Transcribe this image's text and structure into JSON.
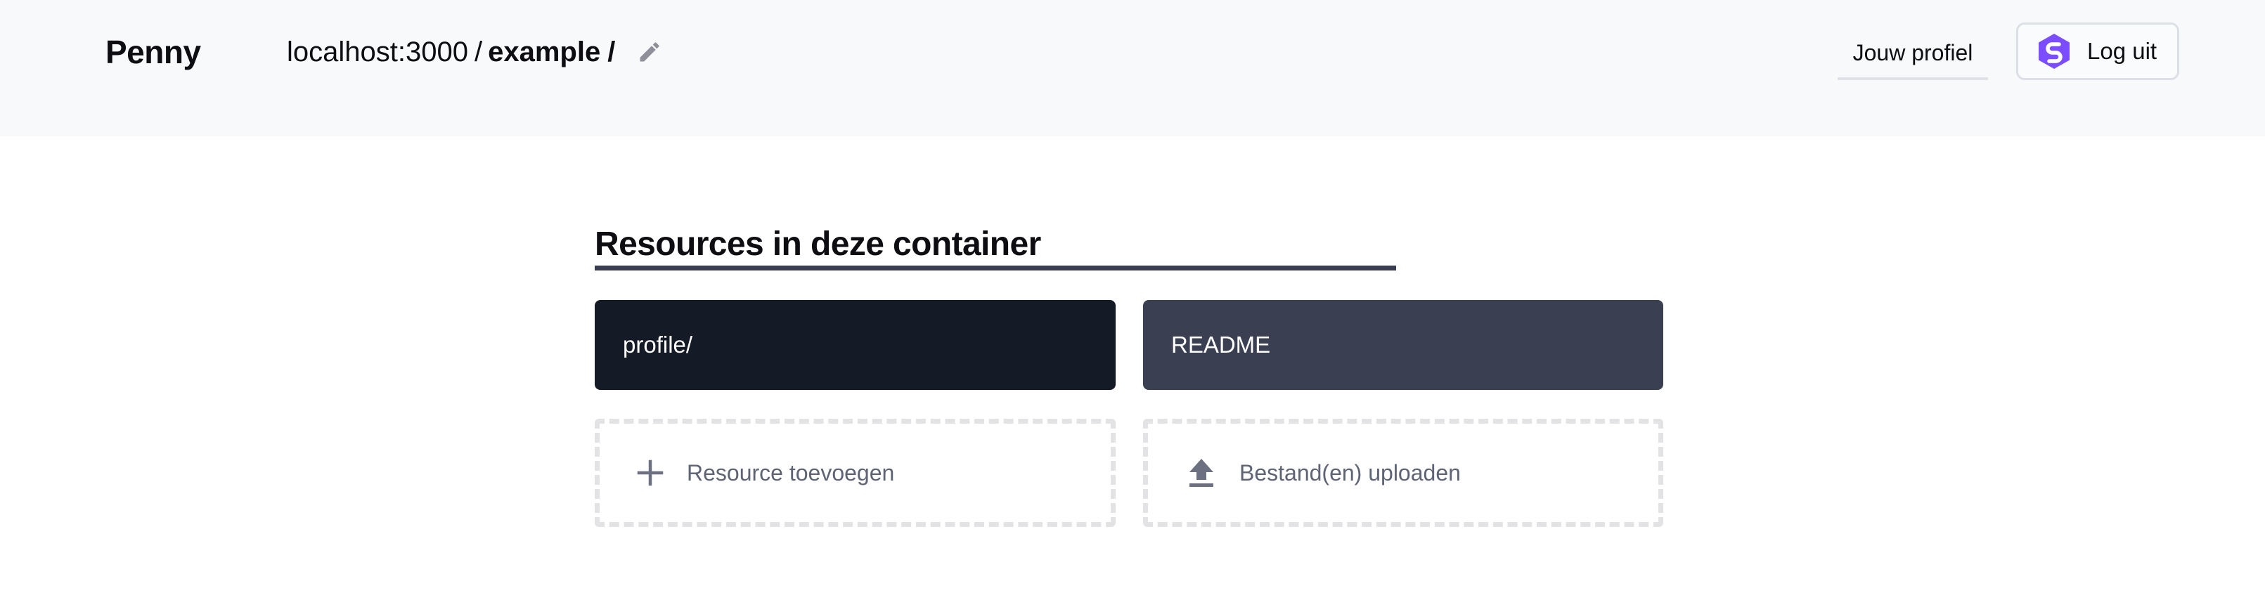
{
  "header": {
    "app_name": "Penny",
    "breadcrumb": {
      "host": "localhost:3000",
      "separator": "/",
      "current": "example",
      "trailing": "/"
    },
    "edit_icon": "pencil-icon",
    "profile_link": "Jouw profiel",
    "logout_label": "Log uit",
    "logout_icon": "solid-logo-icon"
  },
  "main": {
    "section_title": "Resources in deze container",
    "resources": [
      {
        "label": "profile/"
      },
      {
        "label": "README"
      }
    ],
    "actions": [
      {
        "label": "Resource toevoegen",
        "icon": "plus-icon"
      },
      {
        "label": "Bestand(en) uploaden",
        "icon": "upload-icon"
      }
    ]
  },
  "colors": {
    "header_bg": "#f8f9fb",
    "tile_dark": "#151a27",
    "tile_slate": "#3a3f51",
    "accent": "#7c4dff",
    "dashed_border": "#e3e3e6",
    "muted_text": "#5f6475"
  }
}
